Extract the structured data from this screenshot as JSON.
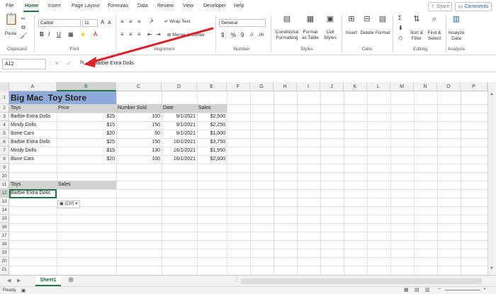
{
  "menu": {
    "tabs": [
      "File",
      "Home",
      "Insert",
      "Page Layout",
      "Formulas",
      "Data",
      "Review",
      "View",
      "Developer",
      "Help"
    ],
    "share": "Share",
    "comments": "Comments"
  },
  "ribbon": {
    "clipboard": {
      "paste": "Paste",
      "group": "Clipboard"
    },
    "font": {
      "name": "Calibri",
      "size": "11",
      "group": "Font"
    },
    "alignment": {
      "wrap": "Wrap Text",
      "merge": "Merge & Center",
      "group": "Alignment"
    },
    "number": {
      "format": "General",
      "group": "Number"
    },
    "styles": {
      "conditional": "Conditional Formatting",
      "format_table": "Format as Table",
      "cell_styles": "Cell Styles",
      "group": "Styles"
    },
    "cells": {
      "insert": "Insert",
      "delete": "Delete",
      "format": "Format",
      "group": "Cells"
    },
    "editing": {
      "sort": "Sort & Filter",
      "find": "Find & Select",
      "group": "Editing"
    },
    "analysis": {
      "analyze": "Analyze Data",
      "group": "Analysis"
    }
  },
  "formula_bar": {
    "name_box": "A12",
    "fx": "fx",
    "value": "Barbie Extra Dolls"
  },
  "columns": [
    "A",
    "B",
    "C",
    "D",
    "E",
    "F",
    "G",
    "H",
    "I",
    "J",
    "K",
    "L",
    "M",
    "N",
    "O",
    "P"
  ],
  "rows": [
    "1",
    "2",
    "3",
    "4",
    "5",
    "6",
    "7",
    "8",
    "9",
    "10",
    "11",
    "12",
    "13",
    "14",
    "15",
    "16",
    "17",
    "18",
    "19",
    "20",
    "21"
  ],
  "sheet": {
    "title": "Big Mac  Toy Store",
    "headers": [
      "Toys",
      "Price",
      "Number Sold",
      "Date",
      "Sales"
    ],
    "data": [
      [
        "Barbie Extra Dolls",
        "$25",
        "100",
        "9/1/2021",
        "$2,500"
      ],
      [
        "Mindy Dolls",
        "$15",
        "150",
        "9/1/2021",
        "$2,250"
      ],
      [
        "Bone Cars",
        "$20",
        "50",
        "9/1/2021",
        "$1,000"
      ],
      [
        "Barbie Extra Dolls",
        "$25",
        "150",
        "16/1/2021",
        "$3,750"
      ],
      [
        "Mindy Dolls",
        "$15",
        "130",
        "16/1/2021",
        "$1,950"
      ],
      [
        "Bone Cars",
        "$20",
        "100",
        "16/1/2021",
        "$2,000"
      ]
    ],
    "headers2": [
      "Toys",
      "Sales"
    ],
    "a12": "Barbie Extra Dolls",
    "paste_options": "(Ctrl)"
  },
  "sheet_tabs": [
    "Sheet1"
  ],
  "status": "Ready",
  "accent": "#217346",
  "title_fill": "#8eaadb"
}
